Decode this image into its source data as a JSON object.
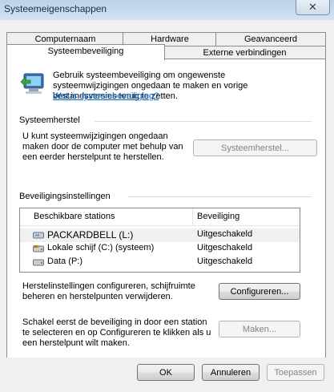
{
  "window": {
    "title": "Systeemeigenschappen",
    "close_glyph": "✕"
  },
  "tabs": {
    "row1": [
      "Computernaam",
      "Hardware",
      "Geavanceerd"
    ],
    "row2": [
      "Systeembeveiliging",
      "Externe verbindingen"
    ],
    "active": "Systeembeveiliging"
  },
  "intro": {
    "text": "Gebruik systeembeveiliging om ongewenste systeemwijzigingen ongedaan te maken en vorige bestandsversies terug te zetten.",
    "link": "Wat is systeembeveiliging?"
  },
  "restore": {
    "title": "Systeemherstel",
    "text": "U kunt systeemwijzigingen ongedaan maken door de computer met behulp van een eerder herstelpunt te herstellen.",
    "button": "Systeemherstel..."
  },
  "protection": {
    "title": "Beveiligingsinstellingen",
    "columns": [
      "Beschikbare stations",
      "Beveiliging"
    ],
    "drives": [
      {
        "name": "PACKARDBELL (L:)",
        "status": "Uitgeschakeld",
        "icon": "removable-drive-icon"
      },
      {
        "name": "Lokale schijf (C:) (systeem)",
        "status": "Uitgeschakeld",
        "icon": "system-drive-icon"
      },
      {
        "name": "Data (P:)",
        "status": "Uitgeschakeld",
        "icon": "hard-drive-icon"
      }
    ],
    "configure_text": "Herstelinstellingen configureren, schijfruimte beheren en herstelpunten verwijderen.",
    "configure_button": "Configureren...",
    "create_text": "Schakel eerst de beveiliging in door een station te selecteren en op Configureren te klikken als u een herstelpunt wilt maken.",
    "create_button": "Maken..."
  },
  "footer": {
    "ok": "OK",
    "cancel": "Annuleren",
    "apply": "Toepassen"
  },
  "colors": {
    "link": "#0066cc",
    "titlebar": "#c8dcf0"
  }
}
